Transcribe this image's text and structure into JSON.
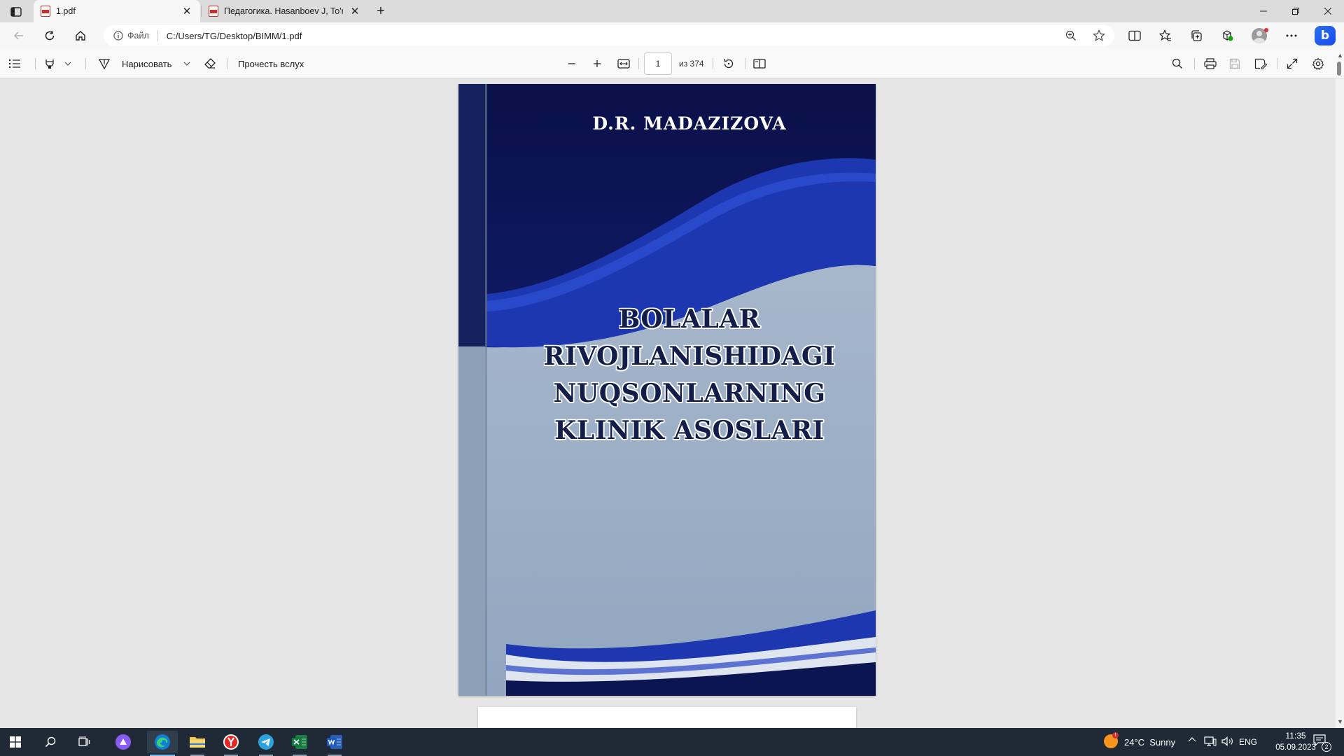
{
  "tabs": [
    {
      "title": "1.pdf",
      "active": true
    },
    {
      "title": "Педагогика. Hasanboev J, To'raqulov",
      "active": false
    }
  ],
  "address_bar": {
    "info_label": "Файл",
    "url": "C:/Users/TG/Desktop/BIMM/1.pdf"
  },
  "pdf_toolbar": {
    "draw_label": "Нарисовать",
    "read_aloud_label": "Прочесть вслух",
    "current_page": "1",
    "total_pages_label": "из 374"
  },
  "cover": {
    "author": "D.R. MADAZIZOVA",
    "title_lines": [
      "BOLALAR",
      "RIVOJLANISHIDAGI",
      "NUQSONLARNING",
      "KLINIK ASOSLARI"
    ],
    "colors": {
      "dark_navy": "#0b1552",
      "royal_blue": "#1f3bb5",
      "light_gray_blue": "#9fb1c8"
    }
  },
  "taskbar": {
    "weather": "24°C  Sunny",
    "language": "ENG",
    "time": "11:35",
    "date": "05.09.2023",
    "notification_count": "2"
  },
  "icons": {
    "tab_actions": "tab-actions-icon",
    "back": "back-arrow-icon",
    "refresh": "refresh-icon",
    "home": "home-icon",
    "info": "info-icon",
    "zoom": "zoom-icon",
    "favorite": "star-icon",
    "split": "split-screen-icon",
    "favorites": "favorites-icon",
    "collections": "collections-icon",
    "extensions": "extensions-icon",
    "more": "more-dots-icon",
    "bing": "bing-icon"
  }
}
